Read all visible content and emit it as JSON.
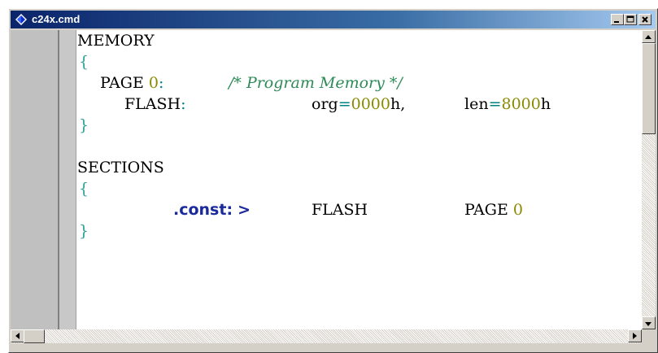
{
  "window": {
    "title": "c24x.cmd",
    "titlebar_color": "#0a246a"
  },
  "icons": {
    "app": "diamond-app-icon",
    "minimize": "minimize-icon",
    "maximize": "maximize-icon",
    "close": "close-icon",
    "scroll_up": "arrow-up-icon",
    "scroll_down": "arrow-down-icon",
    "scroll_left": "arrow-left-icon",
    "scroll_right": "arrow-right-icon"
  },
  "code": {
    "memory_kw": "MEMORY",
    "open_brace_1": "{",
    "page_kw": "PAGE",
    "page_num": "0",
    "page_colon": ":",
    "comment": "/* Program Memory */",
    "flash_label": "FLASH",
    "flash_colon": ":",
    "org_kw": "org",
    "org_eq": "=",
    "org_val": "0000",
    "org_suffix": "h,",
    "len_kw": "len",
    "len_eq": "=",
    "len_val": "8000",
    "len_suffix": "h",
    "close_brace_1": "}",
    "sections_kw": "SECTIONS",
    "open_brace_2": "{",
    "const_section": ".const:",
    "arrow": ">",
    "target": "FLASH",
    "page2_kw": "PAGE",
    "page2_num": "0",
    "close_brace_2": "}"
  },
  "colors": {
    "number": "#8a8a00",
    "brace": "#2aa198",
    "comment": "#2e8b57",
    "section_name": "#1a2a9a"
  }
}
